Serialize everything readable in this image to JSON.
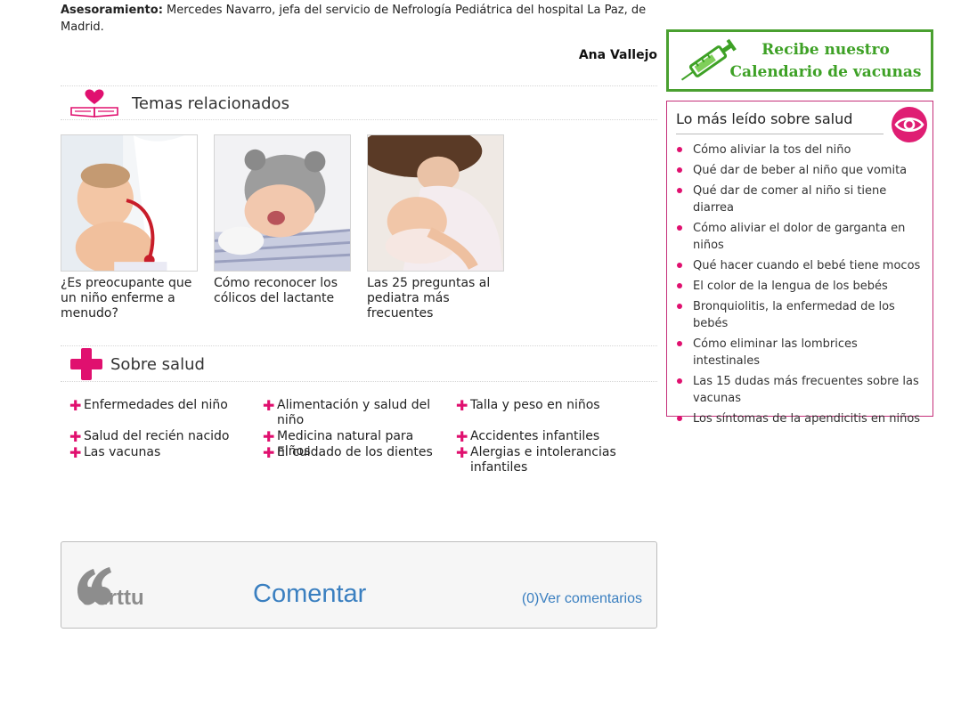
{
  "article": {
    "advice_label": "Asesoramiento:",
    "advice_text": " Mercedes Navarro, jefa del servicio de Nefrología Pediátrica del hospital La Paz, de Madrid.",
    "author": "Ana Vallejo"
  },
  "related": {
    "title": "Temas relacionados",
    "items": [
      {
        "caption": "¿Es preocupante que un niño enferme a menudo?"
      },
      {
        "caption": "Cómo reconocer los cólicos del lactante"
      },
      {
        "caption": "Las 25 preguntas al pediatra más frecuentes"
      }
    ]
  },
  "topics": {
    "title": "Sobre salud",
    "items": [
      "Enfermedades del niño",
      "Alimentación y salud del niño",
      "Talla y peso en niños",
      "Salud del recién nacido",
      "Medicina natural para niños",
      "Accidentes infantiles",
      "Las vacunas",
      "El cuidado de los dientes",
      "Alergias e intolerancias infantiles"
    ]
  },
  "comments": {
    "logo_text": "irttu",
    "comentar_label": "Comentar",
    "ver_label": "(0)Ver comentarios"
  },
  "banner": {
    "line1": "Recibe nuestro",
    "line2": "Calendario de vacunas"
  },
  "most_read": {
    "title": "Lo más leído sobre salud",
    "items": [
      "Cómo aliviar la tos del niño",
      "Qué dar de beber al niño que vomita",
      "Qué dar de comer al niño si tiene diarrea",
      "Cómo aliviar el dolor de garganta en niños",
      "Qué hacer cuando el bebé tiene mocos",
      "El color de la lengua de los bebés",
      "Bronquiolitis, la enfermedad de los bebés",
      "Cómo eliminar las lombrices intestinales",
      "Las 15 dudas más frecuentes sobre las vacunas",
      "Los síntomas de la apendicitis en niños"
    ]
  },
  "colors": {
    "accent_pink": "#e0106f",
    "banner_green": "#3ea126",
    "link_blue": "#3a7fc0"
  }
}
